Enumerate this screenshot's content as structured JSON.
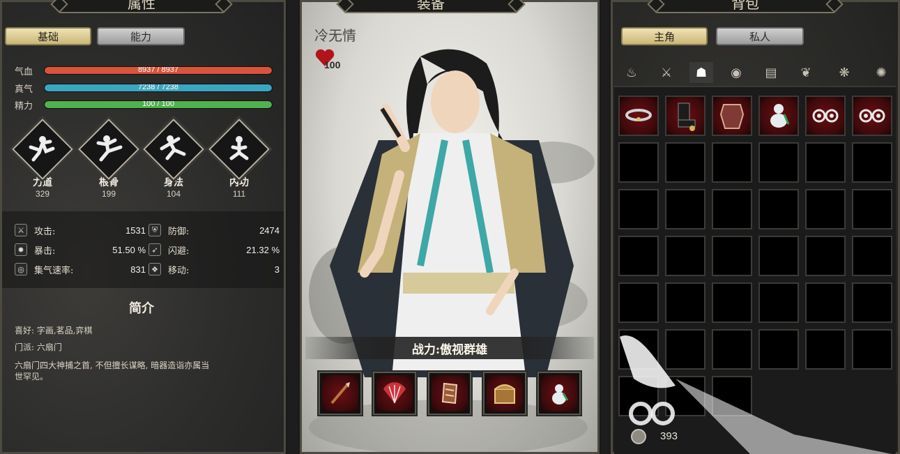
{
  "left_panel": {
    "header": "属性",
    "tabs": [
      {
        "label": "基础",
        "active": true
      },
      {
        "label": "能力",
        "active": false
      }
    ],
    "bars": [
      {
        "label": "气血",
        "text": "8937  /  8937",
        "fraction": 1.0,
        "color": "#d9543c"
      },
      {
        "label": "真气",
        "text": "7238  /  7238",
        "fraction": 1.0,
        "color": "#3ba6c2"
      },
      {
        "label": "精力",
        "text": "100  /  100",
        "fraction": 1.0,
        "color": "#4fb24e"
      }
    ],
    "attributes": [
      {
        "name": "力道",
        "value": "329",
        "icon": "fist-pose-icon"
      },
      {
        "name": "根骨",
        "value": "199",
        "icon": "kick-pose-icon"
      },
      {
        "name": "身法",
        "value": "104",
        "icon": "leap-pose-icon"
      },
      {
        "name": "内功",
        "value": "111",
        "icon": "meditate-pose-icon"
      }
    ],
    "stats": [
      {
        "label": "攻击:",
        "value": "1531",
        "icon": "sword-icon"
      },
      {
        "label": "防御:",
        "value": "2474",
        "icon": "shield-icon"
      },
      {
        "label": "暴击:",
        "value": "51.50 %",
        "icon": "flame-icon"
      },
      {
        "label": "闪避:",
        "value": "21.32 %",
        "icon": "feather-icon"
      },
      {
        "label": "集气速率:",
        "value": "831",
        "icon": "swirl-icon"
      },
      {
        "label": "移动:",
        "value": "3",
        "icon": "boots-icon"
      }
    ],
    "bio": {
      "title": "简介",
      "hobby": "喜好: 字画,茗品,弈棋",
      "sect": "门派: 六扇门",
      "desc_line1": "六扇门四大神捕之首, 不但擅长谋略, 暗器造诣亦属当",
      "desc_line2": "世罕见。"
    }
  },
  "center_panel": {
    "header": "装备",
    "character_name": "冷无情",
    "favor": "100",
    "power_text": "战力:傲视群雄",
    "equipment": [
      {
        "name": "spear-tip",
        "icon": "spear-icon"
      },
      {
        "name": "fan",
        "icon": "fan-icon"
      },
      {
        "name": "bracer",
        "icon": "bracer-icon"
      },
      {
        "name": "treasure-box",
        "icon": "chest-icon"
      },
      {
        "name": "gourd",
        "icon": "gourd-icon"
      }
    ]
  },
  "right_panel": {
    "header": "背包",
    "tabs": [
      {
        "label": "主角",
        "active": true
      },
      {
        "label": "私人",
        "active": false
      }
    ],
    "categories": [
      {
        "icon": "all-items-icon",
        "active": false
      },
      {
        "icon": "weapons-icon",
        "active": false
      },
      {
        "icon": "armor-icon",
        "active": true
      },
      {
        "icon": "accessory-icon",
        "active": false
      },
      {
        "icon": "book-icon",
        "active": false
      },
      {
        "icon": "herb-icon",
        "active": false
      },
      {
        "icon": "material-icon",
        "active": false
      },
      {
        "icon": "misc-icon",
        "active": false
      }
    ],
    "items": [
      {
        "icon": "ring-icon"
      },
      {
        "icon": "boots-icon"
      },
      {
        "icon": "armor-piece-icon"
      },
      {
        "icon": "gourd-icon"
      },
      {
        "icon": "cloud-charm-icon"
      },
      {
        "icon": "cloud-charm-icon"
      }
    ],
    "money": "393"
  },
  "colors": {
    "active_tab": "#e6d79c",
    "equip_slot_red": "#6a0f13",
    "hp": "#d9543c",
    "mp": "#3ba6c2",
    "stamina": "#4fb24e"
  }
}
